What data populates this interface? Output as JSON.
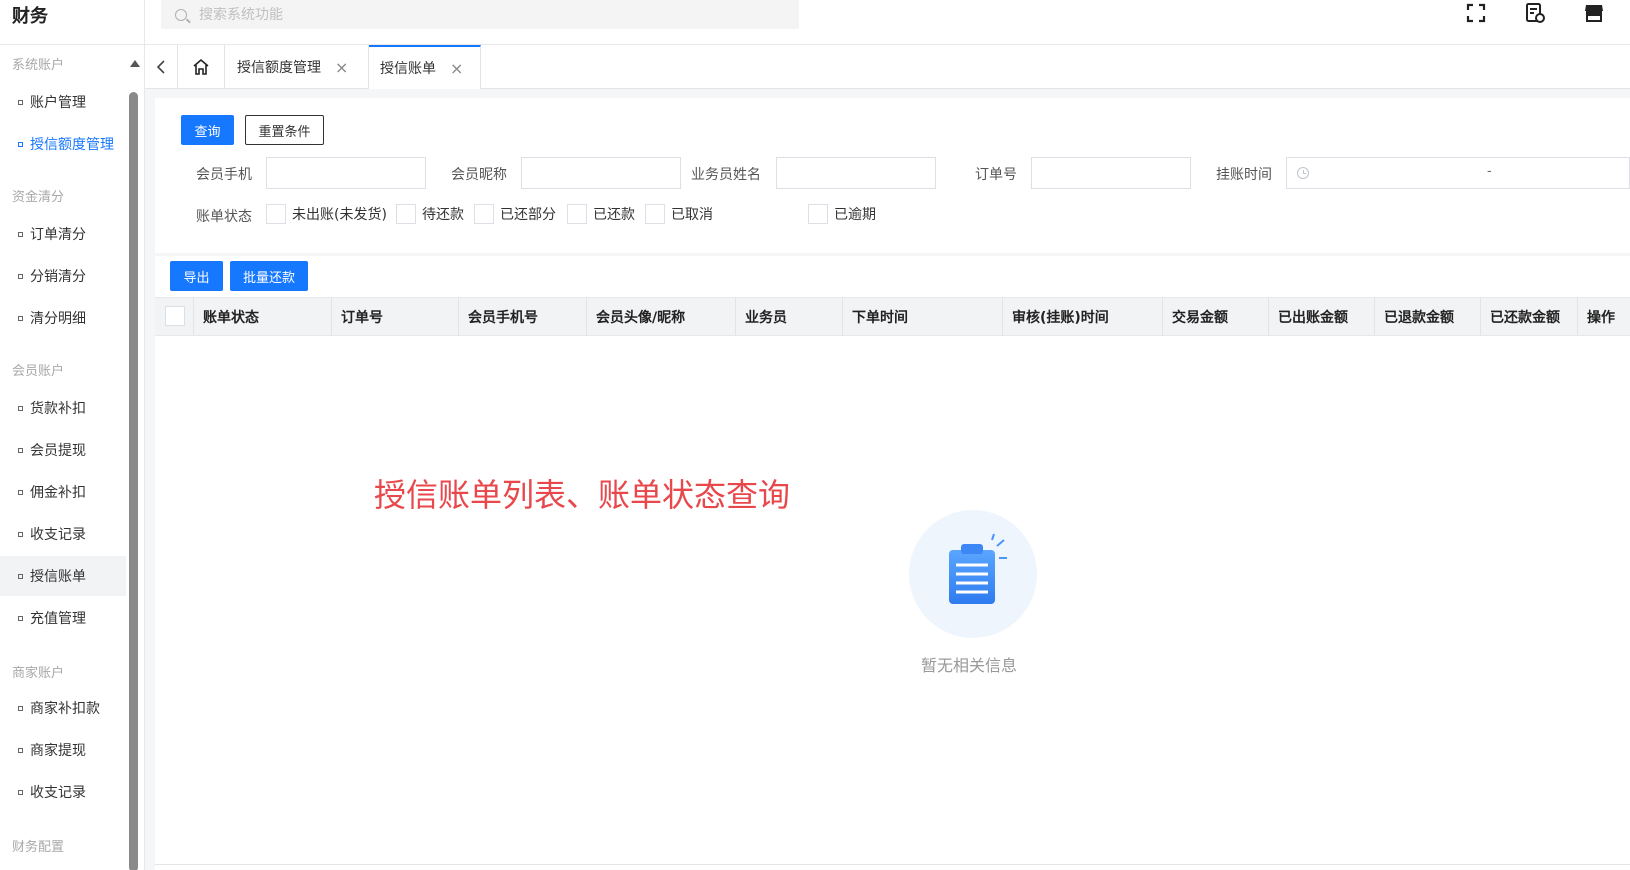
{
  "app": {
    "title": "财务"
  },
  "search": {
    "placeholder": "搜索系统功能"
  },
  "top_icons": [
    "fullscreen-icon",
    "document-settings-icon",
    "store-icon"
  ],
  "sidebar": {
    "groups": [
      {
        "label": "系统账户"
      },
      {
        "label": "资金清分"
      },
      {
        "label": "会员账户"
      },
      {
        "label": "商家账户"
      },
      {
        "label": "财务配置"
      }
    ],
    "items": [
      {
        "label": "账户管理"
      },
      {
        "label": "授信额度管理"
      },
      {
        "label": "订单清分"
      },
      {
        "label": "分销清分"
      },
      {
        "label": "清分明细"
      },
      {
        "label": "货款补扣"
      },
      {
        "label": "会员提现"
      },
      {
        "label": "佣金补扣"
      },
      {
        "label": "收支记录"
      },
      {
        "label": "授信账单"
      },
      {
        "label": "充值管理"
      },
      {
        "label": "商家补扣款"
      },
      {
        "label": "商家提现"
      },
      {
        "label": "收支记录"
      }
    ]
  },
  "tabs": [
    {
      "label": "授信额度管理",
      "close": "×"
    },
    {
      "label": "授信账单",
      "close": "×"
    }
  ],
  "filters": {
    "query_button": "查询",
    "reset_button": "重置条件",
    "member_phone_label": "会员手机",
    "member_nickname_label": "会员昵称",
    "salesperson_label": "业务员姓名",
    "order_no_label": "订单号",
    "hang_time_label": "挂账时间",
    "range_separator": "-",
    "status_label": "账单状态",
    "status_options": [
      "未出账(未发货)",
      "待还款",
      "已还部分",
      "已还款",
      "已取消",
      "已逾期"
    ]
  },
  "toolbar": {
    "export_button": "导出",
    "batch_repay_button": "批量还款"
  },
  "table": {
    "columns": [
      "账单状态",
      "订单号",
      "会员手机号",
      "会员头像/昵称",
      "业务员",
      "下单时间",
      "审核(挂账)时间",
      "交易金额",
      "已出账金额",
      "已退款金额",
      "已还款金额",
      "操作"
    ]
  },
  "annotation": "授信账单列表、账单状态查询",
  "empty_state": {
    "text": "暂无相关信息"
  },
  "colors": {
    "primary": "#1677ff",
    "annotation": "#e8474b"
  }
}
